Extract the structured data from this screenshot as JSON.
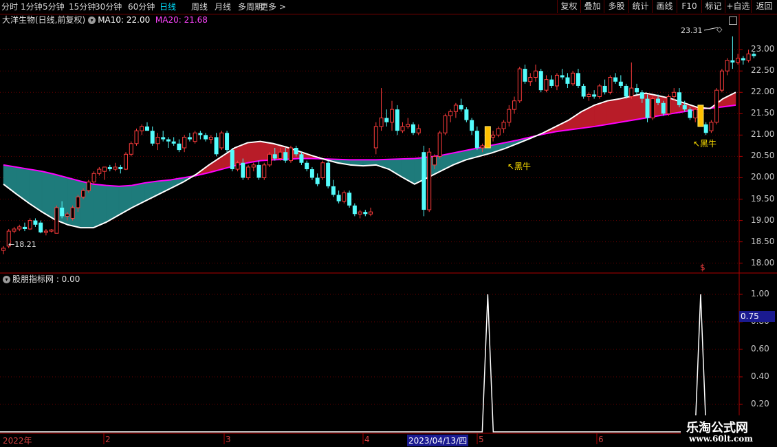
{
  "toolbar": {
    "periods": [
      "分时",
      "1分钟",
      "5分钟",
      "15分钟",
      "30分钟",
      "60分钟",
      "日线",
      "周线",
      "月线",
      "多周期",
      "更多 >"
    ],
    "active_period": "日线",
    "right_buttons": [
      "复权",
      "叠加",
      "多股",
      "统计",
      "画线",
      "F10",
      "标记",
      "+自选",
      "返回"
    ]
  },
  "main_panel": {
    "title": "大洋生物(日线,前复权)",
    "ma10_label": "MA10: 22.00",
    "ma20_label": "MA20: 21.68",
    "high_marker": "23.31",
    "low_marker": "18.21",
    "signal_labels": [
      "↖黑牛",
      "↖黑牛"
    ],
    "dollar_mark": "$",
    "y_ticks": [
      "23.00",
      "22.50",
      "22.00",
      "21.50",
      "21.00",
      "20.50",
      "20.00",
      "19.50",
      "19.00",
      "18.50",
      "18.00"
    ]
  },
  "sub_panel": {
    "title": "股朋指标网 : 0.00",
    "y_ticks": [
      "1.00",
      "0.80",
      "0.60",
      "0.40",
      "0.20"
    ],
    "current_value": "0.75"
  },
  "date_axis": {
    "labels": [
      "2022年",
      "2",
      "3",
      "4",
      "5",
      "6"
    ],
    "cursor_date": "2023/04/13/四"
  },
  "watermark": {
    "line1": "乐淘公式网",
    "line2": "www.60lt.com"
  },
  "colors": {
    "up": "#ff3c3c",
    "down": "#54fcfc",
    "ma10": "#ffffff",
    "ma20": "#ff00ff",
    "fill_up": "#b81c28",
    "fill_down": "#1e7b7b",
    "signal": "#ffc000"
  },
  "chart_data": [
    {
      "type": "candlestick",
      "title": "大洋生物(日线,前复权)",
      "ylim": [
        17.85,
        23.55
      ],
      "ohlc": [
        [
          18.3,
          18.4,
          18.21,
          18.35
        ],
        [
          18.4,
          18.8,
          18.35,
          18.75
        ],
        [
          18.75,
          18.85,
          18.7,
          18.8
        ],
        [
          18.8,
          18.9,
          18.75,
          18.85
        ],
        [
          18.85,
          18.95,
          18.75,
          18.8
        ],
        [
          18.8,
          19.05,
          18.78,
          19.0
        ],
        [
          19.0,
          19.05,
          18.85,
          18.9
        ],
        [
          18.95,
          19.0,
          18.7,
          18.72
        ],
        [
          18.72,
          18.8,
          18.65,
          18.75
        ],
        [
          18.75,
          18.8,
          18.72,
          18.78
        ],
        [
          18.7,
          19.35,
          18.7,
          19.3
        ],
        [
          19.3,
          19.45,
          19.05,
          19.1
        ],
        [
          19.1,
          19.2,
          19.0,
          19.15
        ],
        [
          19.05,
          19.35,
          19.0,
          19.3
        ],
        [
          19.3,
          19.6,
          19.2,
          19.55
        ],
        [
          19.55,
          19.75,
          19.5,
          19.7
        ],
        [
          19.7,
          19.95,
          19.65,
          19.9
        ],
        [
          19.9,
          20.15,
          19.85,
          20.1
        ],
        [
          20.1,
          20.25,
          20.05,
          20.2
        ],
        [
          20.15,
          20.25,
          19.95,
          20.25
        ],
        [
          20.25,
          20.3,
          20.15,
          20.2
        ],
        [
          20.2,
          20.35,
          20.15,
          20.25
        ],
        [
          20.25,
          20.3,
          20.1,
          20.2
        ],
        [
          20.2,
          20.6,
          20.18,
          20.55
        ],
        [
          20.55,
          20.85,
          20.5,
          20.8
        ],
        [
          20.8,
          21.15,
          20.75,
          21.1
        ],
        [
          21.1,
          21.25,
          21.0,
          21.2
        ],
        [
          21.2,
          21.3,
          21.1,
          21.1
        ],
        [
          21.1,
          21.2,
          20.75,
          20.8
        ],
        [
          20.8,
          21.05,
          20.65,
          20.95
        ],
        [
          20.95,
          21.1,
          20.85,
          20.9
        ],
        [
          20.9,
          20.95,
          20.7,
          20.85
        ],
        [
          20.85,
          20.95,
          20.75,
          20.8
        ],
        [
          20.8,
          20.9,
          20.6,
          20.65
        ],
        [
          20.7,
          21.0,
          20.6,
          20.95
        ],
        [
          20.95,
          21.05,
          20.85,
          20.9
        ],
        [
          20.85,
          21.1,
          20.8,
          21.05
        ],
        [
          21.05,
          21.1,
          20.9,
          21.0
        ],
        [
          21.0,
          21.05,
          20.85,
          20.9
        ],
        [
          20.9,
          21.0,
          20.8,
          20.95
        ],
        [
          20.95,
          21.05,
          20.5,
          20.55
        ],
        [
          20.7,
          21.1,
          20.65,
          21.05
        ],
        [
          21.05,
          21.1,
          20.6,
          20.65
        ],
        [
          20.65,
          20.7,
          20.15,
          20.2
        ],
        [
          20.2,
          20.4,
          20.15,
          20.35
        ],
        [
          20.35,
          20.45,
          19.95,
          20.0
        ],
        [
          20.0,
          20.3,
          19.95,
          20.25
        ],
        [
          20.25,
          20.35,
          20.15,
          20.3
        ],
        [
          20.3,
          20.4,
          19.95,
          20.0
        ],
        [
          20.0,
          20.35,
          19.95,
          20.3
        ],
        [
          20.3,
          20.6,
          20.25,
          20.55
        ],
        [
          20.55,
          20.7,
          20.4,
          20.45
        ],
        [
          20.45,
          20.7,
          20.4,
          20.6
        ],
        [
          20.6,
          20.7,
          20.35,
          20.4
        ],
        [
          20.4,
          20.75,
          20.35,
          20.7
        ],
        [
          20.7,
          20.75,
          20.5,
          20.55
        ],
        [
          20.55,
          20.6,
          20.3,
          20.35
        ],
        [
          20.35,
          20.4,
          20.15,
          20.2
        ],
        [
          20.2,
          20.25,
          19.95,
          20.0
        ],
        [
          20.0,
          20.1,
          19.8,
          19.85
        ],
        [
          20.0,
          20.4,
          19.95,
          20.35
        ],
        [
          20.35,
          20.4,
          19.75,
          19.8
        ],
        [
          19.8,
          19.95,
          19.55,
          19.6
        ],
        [
          19.6,
          19.7,
          19.4,
          19.45
        ],
        [
          19.45,
          19.7,
          19.4,
          19.65
        ],
        [
          19.65,
          19.7,
          19.3,
          19.35
        ],
        [
          19.35,
          19.4,
          19.1,
          19.15
        ],
        [
          19.15,
          19.25,
          19.05,
          19.2
        ],
        [
          19.2,
          19.25,
          19.1,
          19.15
        ],
        [
          19.15,
          19.3,
          19.1,
          19.2
        ],
        [
          20.7,
          21.3,
          20.55,
          21.2
        ],
        [
          21.2,
          22.1,
          21.1,
          21.4
        ],
        [
          21.4,
          21.6,
          21.2,
          21.3
        ],
        [
          21.3,
          21.8,
          21.1,
          21.6
        ],
        [
          21.6,
          21.7,
          21.0,
          21.1
        ],
        [
          21.1,
          21.3,
          21.05,
          21.2
        ],
        [
          21.2,
          21.4,
          21.15,
          21.25
        ],
        [
          21.25,
          21.3,
          21.0,
          21.05
        ],
        [
          21.05,
          21.25,
          21.0,
          21.15
        ],
        [
          20.6,
          20.75,
          19.1,
          19.25
        ],
        [
          19.25,
          20.7,
          19.2,
          20.6
        ],
        [
          20.3,
          20.55,
          20.2,
          20.5
        ],
        [
          20.5,
          21.1,
          20.45,
          21.05
        ],
        [
          21.05,
          21.5,
          21.0,
          21.45
        ],
        [
          21.45,
          21.6,
          21.3,
          21.55
        ],
        [
          21.55,
          21.75,
          21.4,
          21.7
        ],
        [
          21.7,
          21.85,
          21.55,
          21.6
        ],
        [
          21.6,
          21.65,
          21.3,
          21.35
        ],
        [
          21.35,
          21.4,
          21.0,
          21.1
        ],
        [
          21.1,
          21.2,
          20.65,
          20.7
        ],
        [
          20.7,
          20.8,
          20.6,
          20.75
        ],
        [
          20.75,
          21.0,
          20.7,
          20.95
        ],
        [
          20.95,
          21.1,
          20.85,
          21.0
        ],
        [
          21.0,
          21.2,
          20.95,
          21.15
        ],
        [
          21.15,
          21.35,
          21.05,
          21.3
        ],
        [
          21.3,
          21.7,
          21.2,
          21.6
        ],
        [
          21.6,
          21.9,
          21.5,
          21.8
        ],
        [
          21.8,
          22.6,
          21.75,
          22.55
        ],
        [
          22.55,
          22.65,
          22.2,
          22.25
        ],
        [
          22.25,
          22.45,
          22.15,
          22.35
        ],
        [
          22.35,
          22.65,
          22.25,
          22.5
        ],
        [
          22.5,
          22.55,
          22.0,
          22.05
        ],
        [
          22.05,
          22.4,
          22.0,
          22.3
        ],
        [
          22.3,
          22.4,
          22.1,
          22.15
        ],
        [
          22.15,
          22.45,
          22.05,
          22.4
        ],
        [
          22.4,
          22.55,
          22.3,
          22.35
        ],
        [
          22.35,
          22.45,
          22.1,
          22.2
        ],
        [
          22.2,
          22.5,
          22.15,
          22.45
        ],
        [
          22.45,
          22.55,
          22.1,
          22.15
        ],
        [
          22.15,
          22.2,
          21.85,
          21.9
        ],
        [
          21.9,
          22.0,
          21.8,
          21.95
        ],
        [
          21.95,
          22.05,
          21.85,
          21.9
        ],
        [
          21.9,
          22.2,
          21.85,
          22.15
        ],
        [
          22.15,
          22.3,
          21.95,
          22.0
        ],
        [
          22.0,
          22.4,
          21.95,
          22.35
        ],
        [
          22.35,
          22.45,
          22.2,
          22.25
        ],
        [
          22.25,
          22.4,
          22.1,
          22.15
        ],
        [
          22.15,
          22.2,
          21.85,
          21.9
        ],
        [
          21.9,
          22.7,
          21.85,
          22.1
        ],
        [
          22.1,
          22.2,
          21.95,
          22.0
        ],
        [
          22.0,
          22.05,
          21.75,
          21.85
        ],
        [
          21.85,
          21.95,
          21.3,
          21.4
        ],
        [
          21.4,
          21.9,
          21.35,
          21.85
        ],
        [
          21.85,
          21.95,
          21.7,
          21.75
        ],
        [
          21.75,
          21.8,
          21.45,
          21.5
        ],
        [
          21.5,
          21.95,
          21.45,
          21.9
        ],
        [
          21.9,
          22.1,
          21.8,
          22.0
        ],
        [
          22.0,
          22.1,
          21.65,
          21.7
        ],
        [
          21.7,
          21.8,
          21.55,
          21.6
        ],
        [
          21.6,
          21.65,
          21.35,
          21.4
        ],
        [
          21.4,
          21.65,
          21.3,
          21.6
        ],
        [
          21.6,
          21.7,
          21.2,
          21.25
        ],
        [
          21.25,
          21.3,
          21.0,
          21.05
        ],
        [
          21.1,
          21.35,
          21.05,
          21.3
        ],
        [
          21.3,
          22.1,
          21.25,
          22.05
        ],
        [
          22.05,
          22.55,
          22.0,
          22.5
        ],
        [
          22.5,
          22.8,
          22.4,
          22.75
        ],
        [
          22.75,
          23.31,
          22.55,
          22.7
        ],
        [
          22.7,
          22.9,
          22.65,
          22.8
        ],
        [
          22.8,
          22.85,
          22.65,
          22.75
        ],
        [
          22.75,
          23.0,
          22.7,
          22.9
        ],
        [
          22.9,
          22.95,
          22.8,
          22.85
        ]
      ],
      "ma10": [
        19.85,
        19.62,
        19.4,
        19.2,
        19.02,
        18.9,
        18.83,
        18.83,
        18.96,
        19.13,
        19.3,
        19.45,
        19.6,
        19.75,
        19.9,
        20.08,
        20.3,
        20.5,
        20.7,
        20.82,
        20.85,
        20.8,
        20.72,
        20.62,
        20.52,
        20.43,
        20.35,
        20.3,
        20.28,
        20.3,
        20.2,
        20.02,
        19.85,
        20.0,
        20.15,
        20.3,
        20.42,
        20.5,
        20.58,
        20.68,
        20.8,
        20.92,
        21.05,
        21.2,
        21.35,
        21.55,
        21.7,
        21.8,
        21.85,
        21.92,
        21.98,
        21.92,
        21.85,
        21.75,
        21.65,
        21.62,
        21.85,
        22.0
      ],
      "ma20": [
        20.3,
        20.25,
        20.2,
        20.15,
        20.08,
        20.0,
        19.92,
        19.85,
        19.82,
        19.8,
        19.82,
        19.88,
        19.92,
        19.95,
        20.0,
        20.05,
        20.12,
        20.2,
        20.28,
        20.35,
        20.4,
        20.42,
        20.43,
        20.45,
        20.45,
        20.44,
        20.43,
        20.42,
        20.42,
        20.42,
        20.43,
        20.44,
        20.45,
        20.48,
        20.52,
        20.58,
        20.64,
        20.7,
        20.76,
        20.82,
        20.88,
        20.95,
        21.02,
        21.08,
        21.12,
        21.16,
        21.2,
        21.25,
        21.3,
        21.35,
        21.4,
        21.45,
        21.5,
        21.55,
        21.6,
        21.63,
        21.66,
        21.7
      ],
      "signals": [
        {
          "bar": 91,
          "label": "↖黑牛"
        },
        {
          "bar": 131,
          "label": "↖黑牛"
        }
      ]
    },
    {
      "type": "line",
      "title": "股朋指标网",
      "ylim": [
        0,
        1.08
      ],
      "spikes": [
        {
          "bar": 91,
          "value": 1.0
        },
        {
          "bar": 131,
          "value": 1.0
        }
      ],
      "baseline": 0.0
    }
  ]
}
